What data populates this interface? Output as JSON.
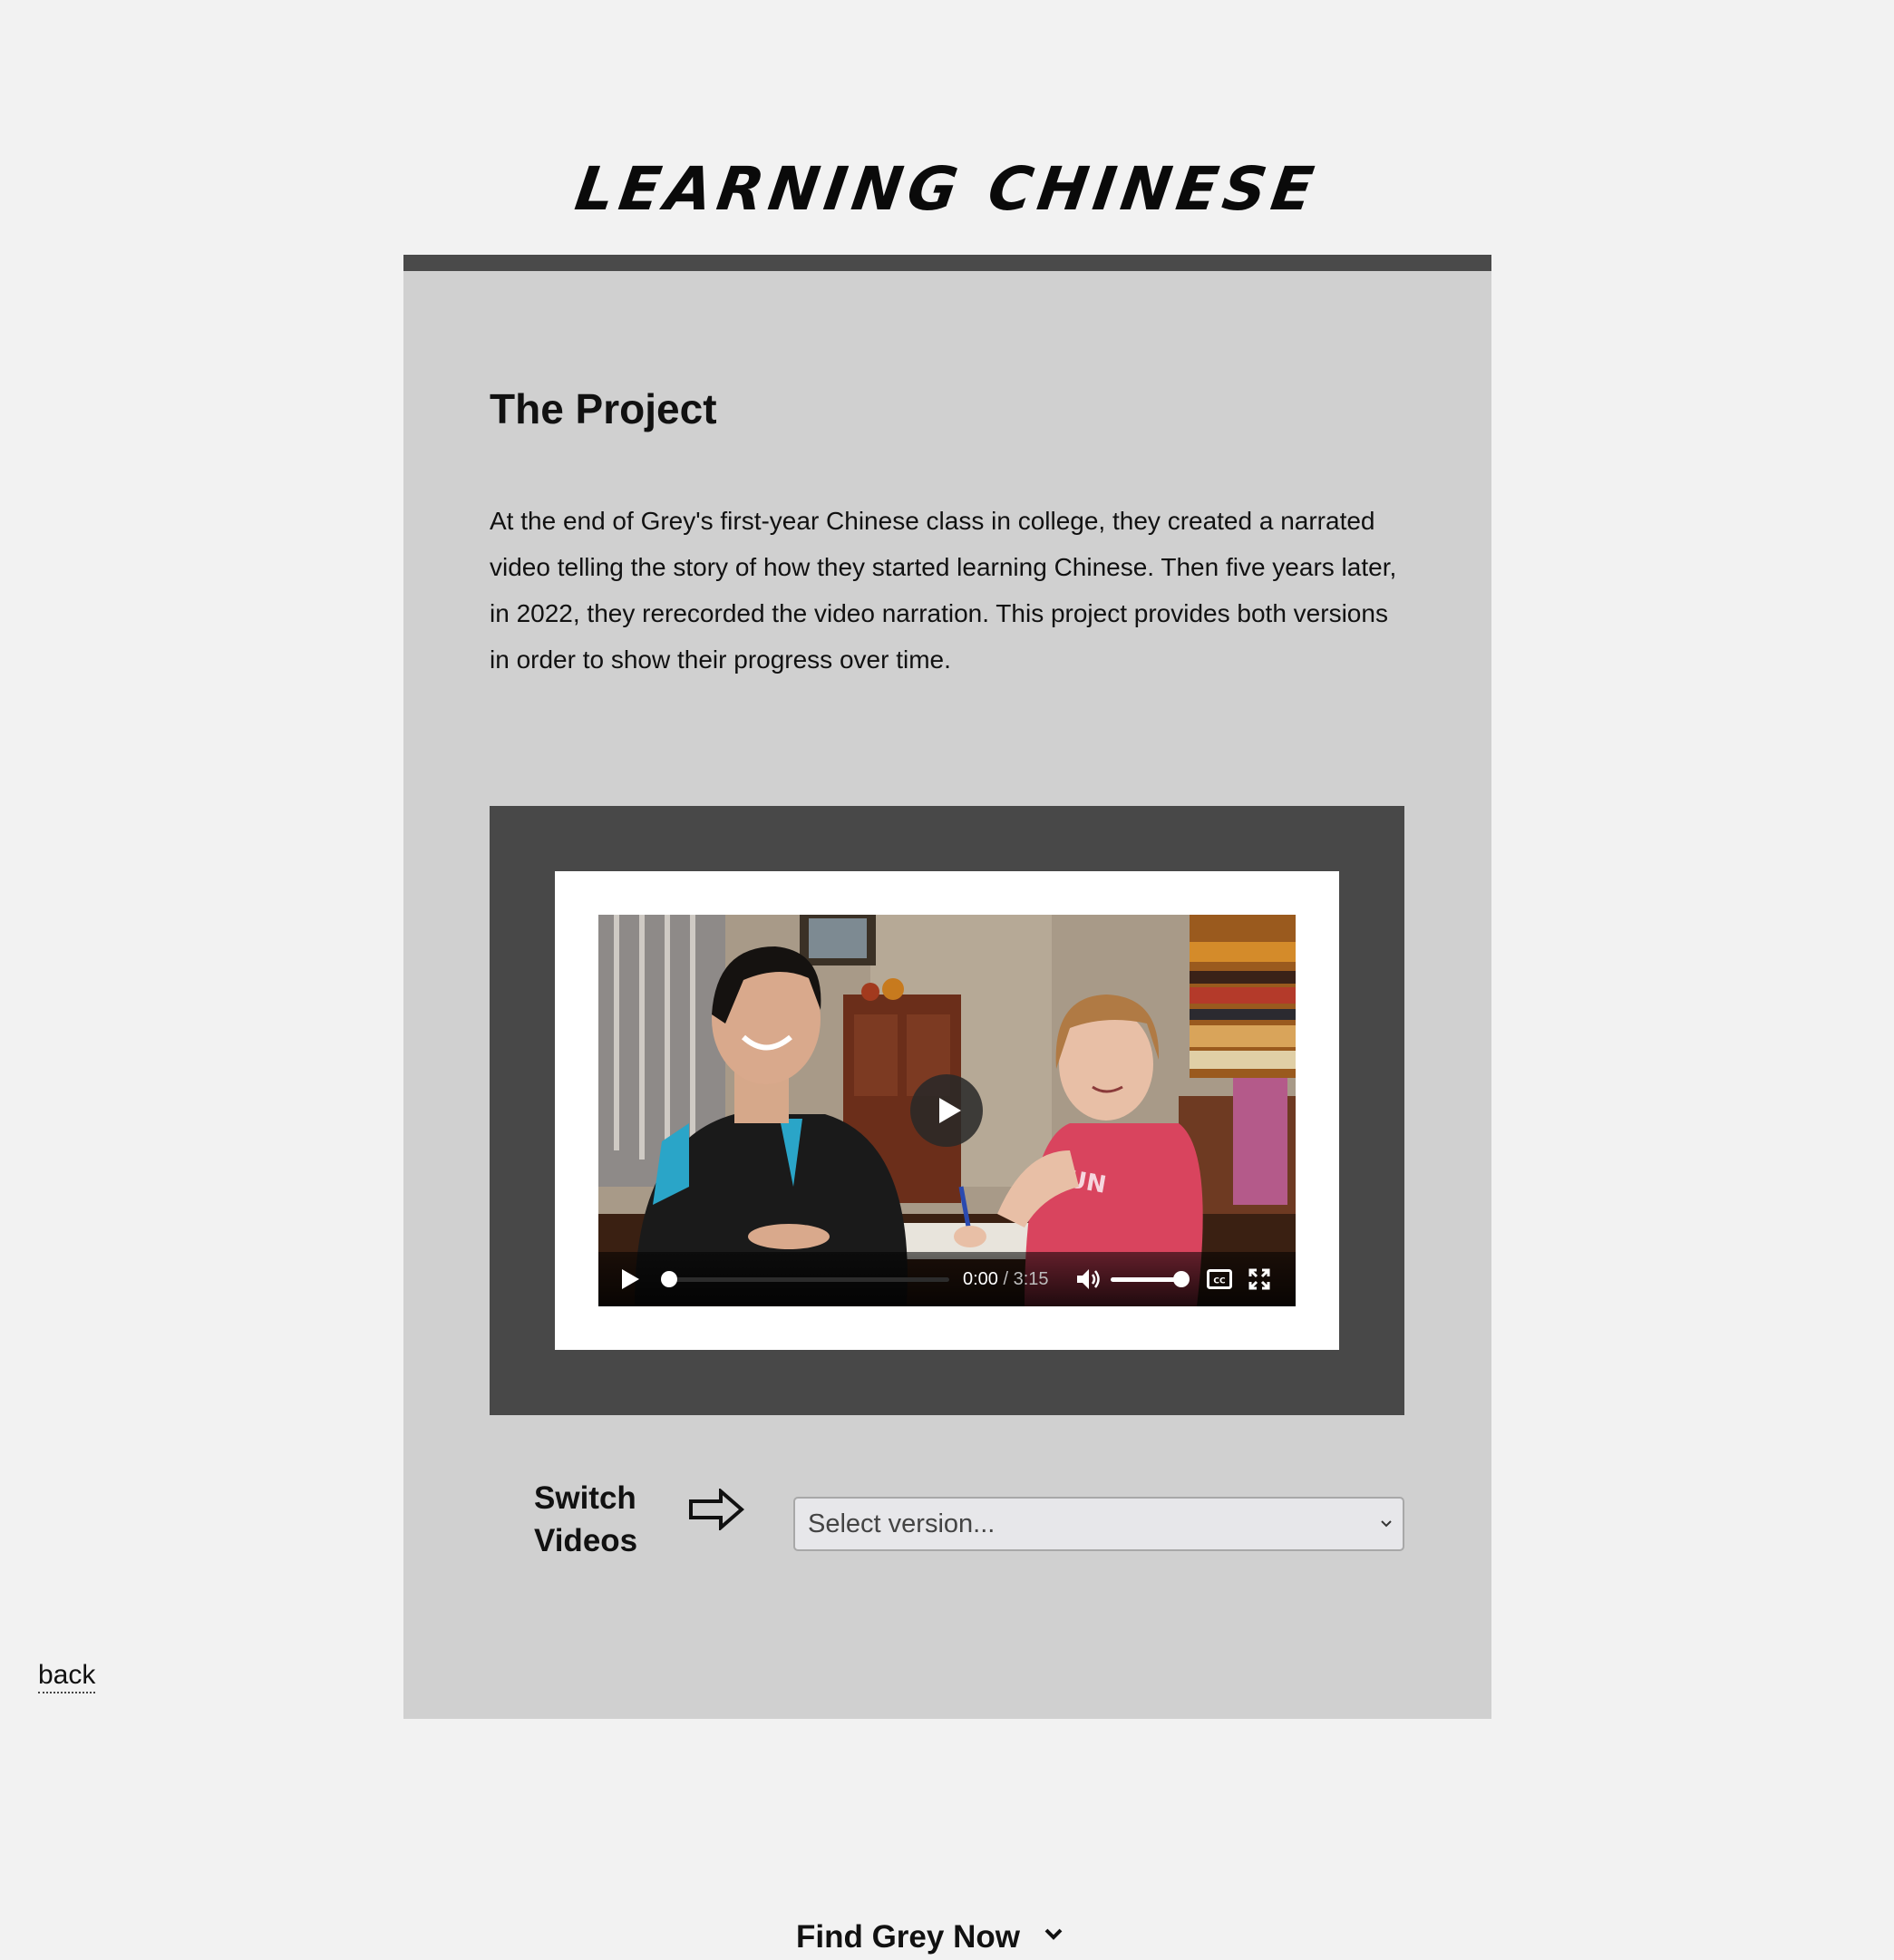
{
  "site": {
    "title": "LEARNING CHINESE"
  },
  "project": {
    "heading": "The Project",
    "description": "At the end of Grey's first-year Chinese class in college, they created a narrated video telling the story of how they started learning Chinese. Then five years later, in 2022, they rerecorded the video narration. This project provides both versions in order to show their progress over time."
  },
  "video": {
    "current_time": "0:00",
    "separator": " / ",
    "duration": "3:15",
    "progress_fraction": 0,
    "volume_fraction": 0.95,
    "icons": {
      "big_play": "play-icon",
      "play": "play-icon",
      "volume": "volume-icon",
      "captions": "captions-icon",
      "fullscreen": "fullscreen-icon"
    }
  },
  "switcher": {
    "label": "Switch Videos",
    "arrow_icon": "right-arrow-icon",
    "select_value": "Select version..."
  },
  "footer": {
    "find_label": "Find Grey Now",
    "back_label": "back"
  },
  "colors": {
    "page_bg": "#f2f2f2",
    "panel_bg": "#d0d0d0",
    "panel_border": "#4a4a4a",
    "video_frame": "#484848",
    "select_bg": "#e7e7ea"
  }
}
